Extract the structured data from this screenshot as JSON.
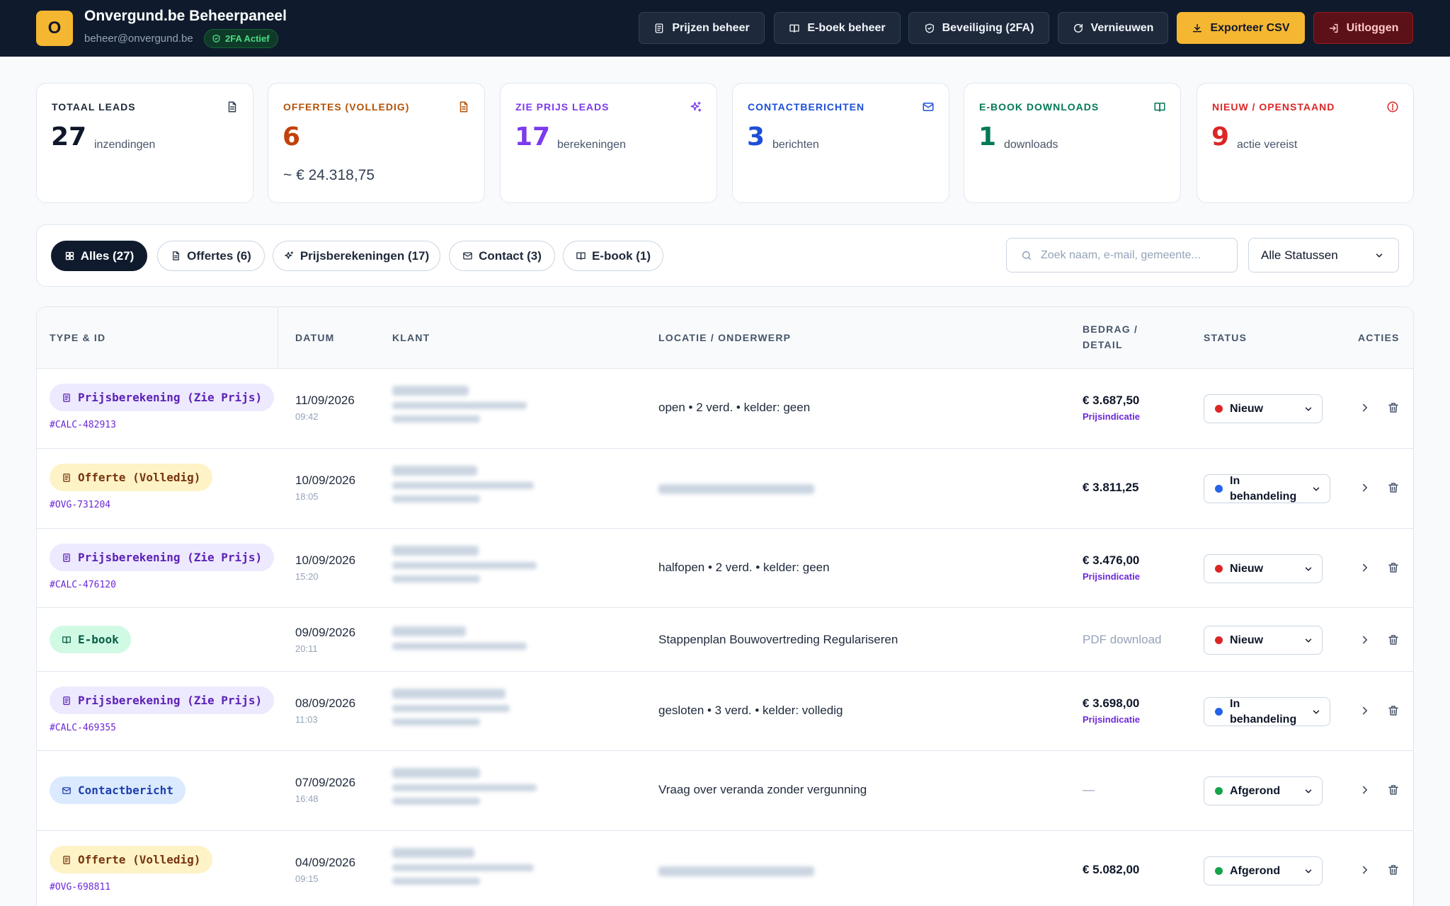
{
  "header": {
    "logo_letter": "O",
    "title": "Onvergund.be Beheerpaneel",
    "email": "beheer@onvergund.be",
    "twofa_badge": "2FA Actief",
    "buttons": {
      "prices": "Prijzen beheer",
      "ebook": "E-boek beheer",
      "security": "Beveiliging (2FA)",
      "refresh": "Vernieuwen",
      "export": "Exporteer CSV",
      "logout": "Uitloggen"
    }
  },
  "stats": [
    {
      "label": "TOTAAL LEADS",
      "value": "27",
      "unit": "inzendingen",
      "color": "#0f172a",
      "label_color": "#1e293b",
      "icon": "document-icon"
    },
    {
      "label": "OFFERTES (VOLLEDIG)",
      "value": "6",
      "unit": "",
      "sub": "~ € 24.318,75",
      "color": "#c2410c",
      "label_color": "#b45309",
      "icon": "document-icon"
    },
    {
      "label": "ZIE PRIJS LEADS",
      "value": "17",
      "unit": "berekeningen",
      "color": "#7c3aed",
      "label_color": "#7c3aed",
      "icon": "sparkles-icon"
    },
    {
      "label": "CONTACTBERICHTEN",
      "value": "3",
      "unit": "berichten",
      "color": "#1d4ed8",
      "label_color": "#1d4ed8",
      "icon": "mail-icon"
    },
    {
      "label": "E-BOOK DOWNLOADS",
      "value": "1",
      "unit": "downloads",
      "color": "#047857",
      "label_color": "#047857",
      "icon": "book-icon"
    },
    {
      "label": "NIEUW / OPENSTAAND",
      "value": "9",
      "unit": "actie vereist",
      "color": "#dc2626",
      "label_color": "#dc2626",
      "icon": "alert-circle-icon"
    }
  ],
  "filters": {
    "tabs": [
      "Alles (27)",
      "Offertes (6)",
      "Prijsberekeningen (17)",
      "Contact (3)",
      "E-book (1)"
    ],
    "active_tab": "Alles (27)",
    "search_placeholder": "Zoek naam, e-mail, gemeente...",
    "status_select": "Alle Statussen"
  },
  "table": {
    "columns": [
      "TYPE & ID",
      "DATUM",
      "KLANT",
      "LOCATIE / ONDERWERP",
      "BEDRAG / DETAIL",
      "STATUS",
      "ACTIES"
    ],
    "rows": [
      {
        "type": "Prijsberekening (Zie Prijs)",
        "id": "#CALC-482913",
        "date": "11/09/2026",
        "time": "09:42",
        "location": "open • 2 verd. • kelder: geen",
        "amount": "€ 3.687,50",
        "amount_note": "Prijsindicatie",
        "status": "Nieuw"
      },
      {
        "type": "Offerte (Volledig)",
        "id": "#OVG-731204",
        "date": "10/09/2026",
        "time": "18:05",
        "location": "",
        "amount": "€ 3.811,25",
        "amount_note": "",
        "status": "In behandeling"
      },
      {
        "type": "Prijsberekening (Zie Prijs)",
        "id": "#CALC-476120",
        "date": "10/09/2026",
        "time": "15:20",
        "location": "halfopen • 2 verd. • kelder: geen",
        "amount": "€ 3.476,00",
        "amount_note": "Prijsindicatie",
        "status": "Nieuw"
      },
      {
        "type": "E-book",
        "id": "",
        "date": "09/09/2026",
        "time": "20:11",
        "location": "Stappenplan Bouwovertreding Regulariseren",
        "amount": "PDF download",
        "amount_note": "",
        "status": "Nieuw"
      },
      {
        "type": "Prijsberekening (Zie Prijs)",
        "id": "#CALC-469355",
        "date": "08/09/2026",
        "time": "11:03",
        "location": "gesloten • 3 verd. • kelder: volledig",
        "amount": "€ 3.698,00",
        "amount_note": "Prijsindicatie",
        "status": "In behandeling"
      },
      {
        "type": "Contactbericht",
        "id": "",
        "date": "07/09/2026",
        "time": "16:48",
        "location": "Vraag over veranda zonder vergunning",
        "amount": "—",
        "amount_note": "",
        "status": "Afgerond"
      },
      {
        "type": "Offerte (Volledig)",
        "id": "#OVG-698811",
        "date": "04/09/2026",
        "time": "09:15",
        "location": "",
        "amount": "€ 5.082,00",
        "amount_note": "",
        "status": "Afgerond"
      }
    ]
  },
  "colors": {
    "header_bg": "#0f1b2d",
    "accent_yellow": "#f5b731",
    "status_new": "#dc2626",
    "status_in_progress": "#2563eb",
    "status_done": "#16a34a"
  }
}
